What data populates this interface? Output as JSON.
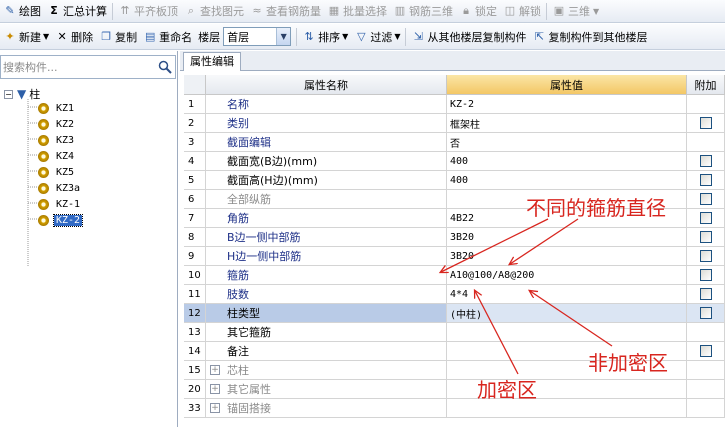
{
  "toolbar1": {
    "items": [
      {
        "label": "绘图",
        "icon": "pencil-icon",
        "disabled": false
      },
      {
        "label": "汇总计算",
        "icon": "sigma-icon",
        "disabled": false
      },
      {
        "label": "平齐板顶",
        "icon": "align-top-icon",
        "disabled": true
      },
      {
        "label": "查找图元",
        "icon": "find-icon",
        "disabled": true
      },
      {
        "label": "查看钢筋量",
        "icon": "rebar-view-icon",
        "disabled": true
      },
      {
        "label": "批量选择",
        "icon": "batch-select-icon",
        "disabled": true
      },
      {
        "label": "钢筋三维",
        "icon": "rebar-3d-icon",
        "disabled": true
      },
      {
        "label": "锁定",
        "icon": "lock-icon",
        "disabled": true
      },
      {
        "label": "解锁",
        "icon": "unlock-icon",
        "disabled": true
      }
    ],
    "view_select": "三维"
  },
  "toolbar2": {
    "new": "新建",
    "delete": "删除",
    "copy": "复制",
    "rename": "重命名",
    "floor_label": "楼层",
    "floor_value": "首层",
    "sort": "排序",
    "filter": "过滤",
    "copy_from": "从其他楼层复制构件",
    "copy_to": "复制构件到其他楼层"
  },
  "search": {
    "placeholder": "搜索构件..."
  },
  "tree": {
    "root": "柱",
    "items": [
      "KZ1",
      "KZ2",
      "KZ3",
      "KZ4",
      "KZ5",
      "KZ3a",
      "KZ-1",
      "KZ-2"
    ],
    "selected_index": 7
  },
  "tab": {
    "label": "属性编辑"
  },
  "table": {
    "headers": {
      "num": "",
      "name": "属性名称",
      "value": "属性值",
      "add": "附加"
    },
    "rows": [
      {
        "num": "1",
        "name": "名称",
        "value": "KZ-2",
        "style": "blue",
        "check": false
      },
      {
        "num": "2",
        "name": "类别",
        "value": "框架柱",
        "style": "blue",
        "check": true
      },
      {
        "num": "3",
        "name": "截面编辑",
        "value": "否",
        "style": "blue",
        "check": false
      },
      {
        "num": "4",
        "name": "截面宽(B边)(mm)",
        "value": "400",
        "style": "black",
        "check": true
      },
      {
        "num": "5",
        "name": "截面高(H边)(mm)",
        "value": "400",
        "style": "black",
        "check": true
      },
      {
        "num": "6",
        "name": "全部纵筋",
        "value": "",
        "style": "gray",
        "check": true
      },
      {
        "num": "7",
        "name": "角筋",
        "value": "4B22",
        "style": "blue",
        "check": true
      },
      {
        "num": "8",
        "name": "B边一侧中部筋",
        "value": "3B20",
        "style": "blue",
        "check": true
      },
      {
        "num": "9",
        "name": "H边一侧中部筋",
        "value": "3B20",
        "style": "blue",
        "check": true
      },
      {
        "num": "10",
        "name": "箍筋",
        "value": "A10@100/A8@200",
        "style": "blue",
        "check": true
      },
      {
        "num": "11",
        "name": "肢数",
        "value": "4*4",
        "style": "blue",
        "check": true
      },
      {
        "num": "12",
        "name": "柱类型",
        "value": "(中柱)",
        "style": "black",
        "check": true
      },
      {
        "num": "13",
        "name": "其它箍筋",
        "value": "",
        "style": "black",
        "check": false
      },
      {
        "num": "14",
        "name": "备注",
        "value": "",
        "style": "black",
        "check": true
      },
      {
        "num": "15",
        "name": "芯柱",
        "value": "",
        "style": "gray",
        "check": false,
        "expand": true
      },
      {
        "num": "20",
        "name": "其它属性",
        "value": "",
        "style": "gray",
        "check": false,
        "expand": true
      },
      {
        "num": "33",
        "name": "锚固搭接",
        "value": "",
        "style": "gray",
        "check": false,
        "expand": true
      }
    ],
    "selected_row": "12"
  },
  "annotations": {
    "diameter": "不同的箍筋直径",
    "non_dense": "非加密区",
    "dense": "加密区"
  },
  "colors": {
    "annotation": "#d8261f",
    "selection": "#316ac5"
  }
}
